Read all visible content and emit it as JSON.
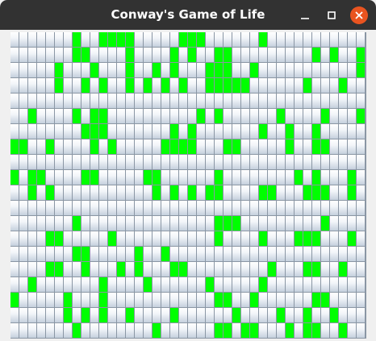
{
  "window": {
    "title": "Conway's Game of Life",
    "buttons": {
      "minimize": "minimize-icon",
      "maximize": "maximize-icon",
      "close": "close-icon"
    }
  },
  "board": {
    "columns": 40,
    "rows": 20,
    "alive_color": "#00ff00",
    "dead_color": "#e6ebf2",
    "cells": [
      "0000000100111100000111000000100000000000",
      "0000000110000100001010011000000000101001",
      "0000010001000100101000111001000000000001",
      "0000010010100101010100111110000001000100",
      "0000000000000000000000000000000000000000",
      "0010000101100000000001010000001000010001",
      "0000000011100000001010000000100100100000",
      "1100100001010000011110001100000100110000",
      "0000000000000000000000000000000000000000",
      "1011000011000001100000010000000010100010",
      "0010100000000000101010110000110001110010",
      "0000000000000000000000000000000000000000",
      "0000000100000000000000011100000000010000",
      "0000110000010000000000010000100011100010",
      "0000000110000010010000000000000000000000",
      "0000110010001010001100000000010001100100",
      "0010000000100001000000100000100000000000",
      "1000001000100000000000011001000000110000",
      "0000001010100100001000000100001001001000",
      "0000000100000000100000011011000101100100"
    ]
  }
}
